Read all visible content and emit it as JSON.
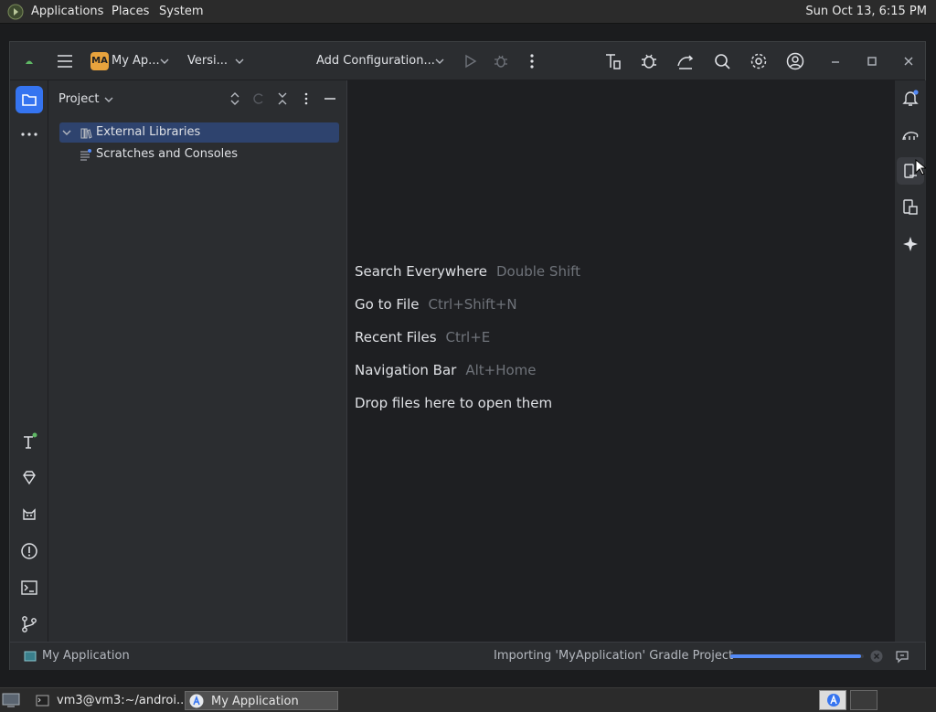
{
  "system_bar": {
    "menus": [
      "Applications",
      "Places",
      "System"
    ],
    "clock": "Sun Oct 13,  6:15 PM"
  },
  "toolbar": {
    "project_badge": "MA",
    "project_name": "My Ap...",
    "vcs_label": "Versi...",
    "run_config": "Add Configuration...",
    "window_controls": [
      "minimize-icon",
      "maximize-icon",
      "close-icon"
    ]
  },
  "project_panel": {
    "title": "Project",
    "tree": [
      {
        "label": "External Libraries",
        "selected": true,
        "expandable": true
      },
      {
        "label": "Scratches and Consoles",
        "selected": false,
        "expandable": false
      }
    ]
  },
  "editor": {
    "hints": [
      {
        "action": "Search Everywhere",
        "shortcut": "Double Shift"
      },
      {
        "action": "Go to File",
        "shortcut": "Ctrl+Shift+N"
      },
      {
        "action": "Recent Files",
        "shortcut": "Ctrl+E"
      },
      {
        "action": "Navigation Bar",
        "shortcut": "Alt+Home"
      },
      {
        "action": "Drop files here to open them",
        "shortcut": ""
      }
    ]
  },
  "status_bar": {
    "project": "My Application",
    "task": "Importing 'MyApplication' Gradle Project",
    "progress": 0.98
  },
  "taskbar": {
    "items": [
      {
        "label": "vm3@vm3:~/androi...",
        "active": false
      },
      {
        "label": "My Application",
        "active": true
      }
    ]
  },
  "colors": {
    "accent": "#3574f0",
    "selection": "#2e436e",
    "progress": "#548af7",
    "dot_green": "#5fb865"
  }
}
